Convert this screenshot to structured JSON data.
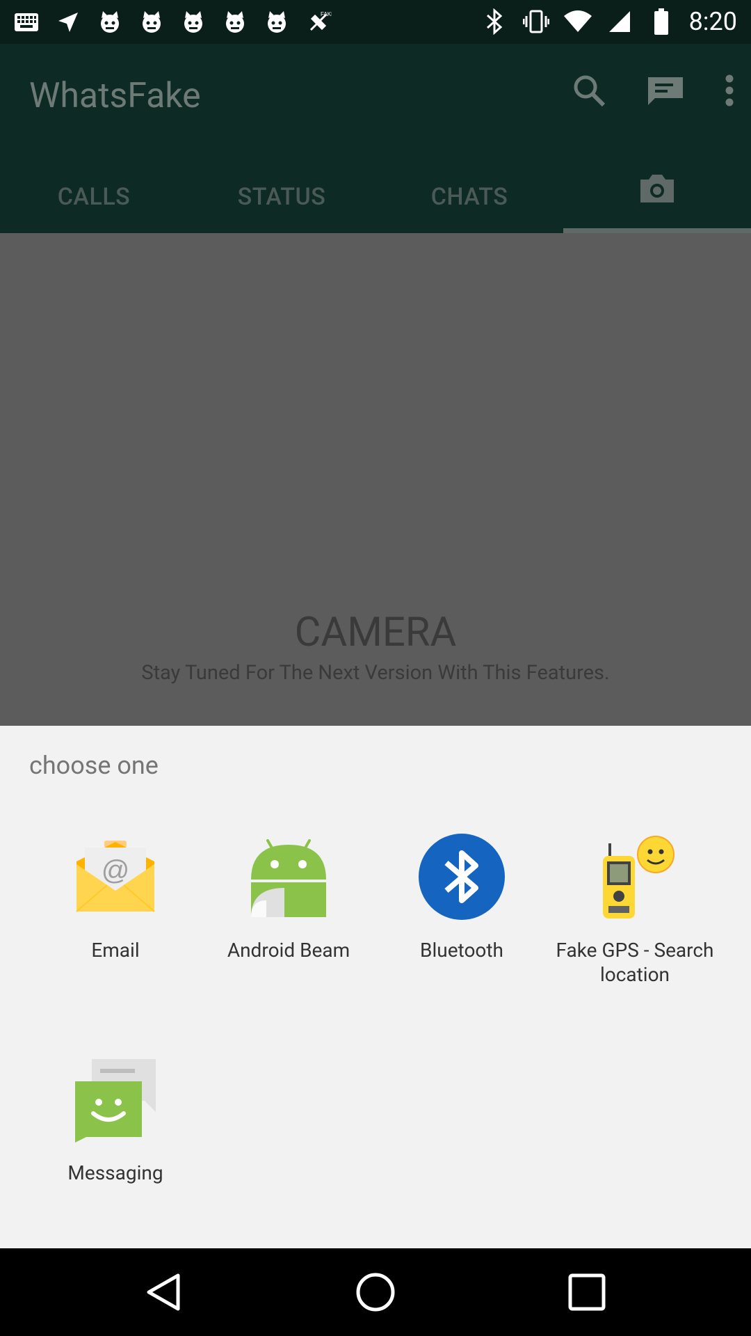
{
  "status_bar": {
    "time": "8:20",
    "left_icons": [
      "keyboard-icon",
      "navigation-icon",
      "cat-icon",
      "cat-icon",
      "cat-icon",
      "cat-icon",
      "cat-icon",
      "fake-gps-icon"
    ],
    "right_icons": [
      "bluetooth-icon",
      "vibrate-icon",
      "wifi-icon",
      "signal-icon",
      "battery-icon"
    ]
  },
  "app_bar": {
    "title": "WhatsFake",
    "actions": [
      "search-icon",
      "new-message-icon",
      "more-options-icon"
    ],
    "tabs": [
      {
        "label": "CALLS"
      },
      {
        "label": "STATUS"
      },
      {
        "label": "CHATS"
      },
      {
        "label": "",
        "icon": "camera-icon"
      }
    ]
  },
  "content": {
    "title": "CAMERA",
    "subtitle": "Stay Tuned For The Next Version With This Features."
  },
  "chooser": {
    "title": "choose one",
    "apps": [
      {
        "label": "Email",
        "icon": "email-icon"
      },
      {
        "label": "Android Beam",
        "icon": "android-beam-icon"
      },
      {
        "label": "Bluetooth",
        "icon": "bluetooth-icon"
      },
      {
        "label": "Fake GPS - Search location",
        "icon": "fake-gps-icon"
      },
      {
        "label": "Messaging",
        "icon": "messaging-icon"
      }
    ]
  },
  "colors": {
    "bluetooth": "#1565c0",
    "android_green": "#8bc34a",
    "email_yellow": "#ffd54f",
    "messaging_green": "#8bc34a"
  }
}
